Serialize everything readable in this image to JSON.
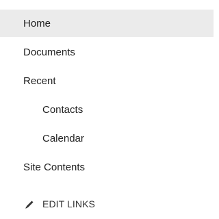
{
  "nav": {
    "items": [
      {
        "label": "Home",
        "level": 0,
        "selected": true
      },
      {
        "label": "Documents",
        "level": 0,
        "selected": false
      },
      {
        "label": "Recent",
        "level": 0,
        "selected": false
      },
      {
        "label": "Contacts",
        "level": 1,
        "selected": false
      },
      {
        "label": "Calendar",
        "level": 1,
        "selected": false
      },
      {
        "label": "Site Contents",
        "level": 0,
        "selected": false
      }
    ],
    "edit_links": {
      "label": "EDIT LINKS",
      "icon": "pencil-icon"
    }
  },
  "colors": {
    "selected_background": "#ebebeb",
    "text": "#222222"
  }
}
